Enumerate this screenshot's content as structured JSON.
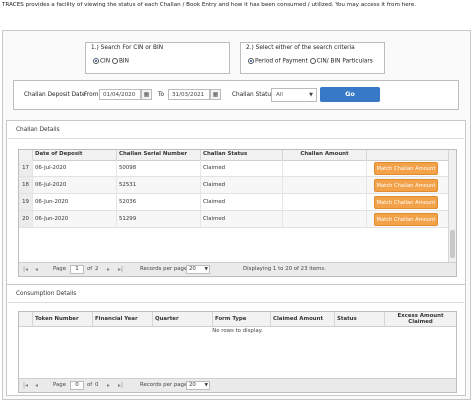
{
  "intro_text": "TRACES provides a facility of viewing the status of each Challan / Book Entry and how it has been consumed / utilized. You may access it from here.",
  "search": {
    "search_for_label": "1.) Search For CIN or BIN",
    "cin_label": "CIN",
    "bin_label": "BIN",
    "criteria_label": "2.) Select either of the search criteria",
    "period_label": "Period of Payment",
    "particulars_label": "CIN/ BIN Particulars"
  },
  "filter": {
    "deposit_date_label": "Challan Deposit Date",
    "from_label": "From",
    "from_value": "01/04/2020",
    "to_label": "To",
    "to_value": "31/03/2021",
    "status_label": "Challan Status",
    "status_value": "All",
    "go_label": "Go"
  },
  "challan_details": {
    "title": "Challan Details",
    "columns": [
      "Date of Deposit",
      "Challan Serial Number",
      "Challan Status",
      "Challan Amount"
    ],
    "rows": [
      {
        "num": "17",
        "date": "06-Jul-2020",
        "serial": "50098",
        "status": "Claimed",
        "amount": "",
        "action": "Match Challan Amount"
      },
      {
        "num": "18",
        "date": "06-Jul-2020",
        "serial": "52531",
        "status": "Claimed",
        "amount": "",
        "action": "Match Challan Amount"
      },
      {
        "num": "19",
        "date": "06-Jun-2020",
        "serial": "52036",
        "status": "Claimed",
        "amount": "",
        "action": "Match Challan Amount"
      },
      {
        "num": "20",
        "date": "06-Jun-2020",
        "serial": "51299",
        "status": "Claimed",
        "amount": "",
        "action": "Match Challan Amount"
      }
    ],
    "pager": {
      "page_label": "Page",
      "page_value": "1",
      "of_label": "of",
      "total_pages": "2",
      "records_label": "Records per page:",
      "records_value": "20",
      "display_text": "Displaying 1 to 20 of 23 items."
    }
  },
  "consumption_details": {
    "title": "Consumption Details",
    "columns": [
      "Token Number",
      "Financial Year",
      "Quarter",
      "Form Type",
      "Claimed Amount",
      "Status",
      "Excess Amount Claimed"
    ],
    "empty_text": "No rows to display.",
    "pager": {
      "page_label": "Page",
      "page_value": "0",
      "of_label": "of",
      "total_pages": "0",
      "records_label": "Records per page:",
      "records_value": "20"
    }
  },
  "icons": {
    "calendar": "calendar-icon",
    "dropdown": "chevron-down-icon",
    "first": "first-page-icon",
    "prev": "prev-page-icon",
    "next": "next-page-icon",
    "last": "last-page-icon"
  },
  "colors": {
    "go_button": "#3778c7",
    "match_button": "#f3a24a"
  }
}
